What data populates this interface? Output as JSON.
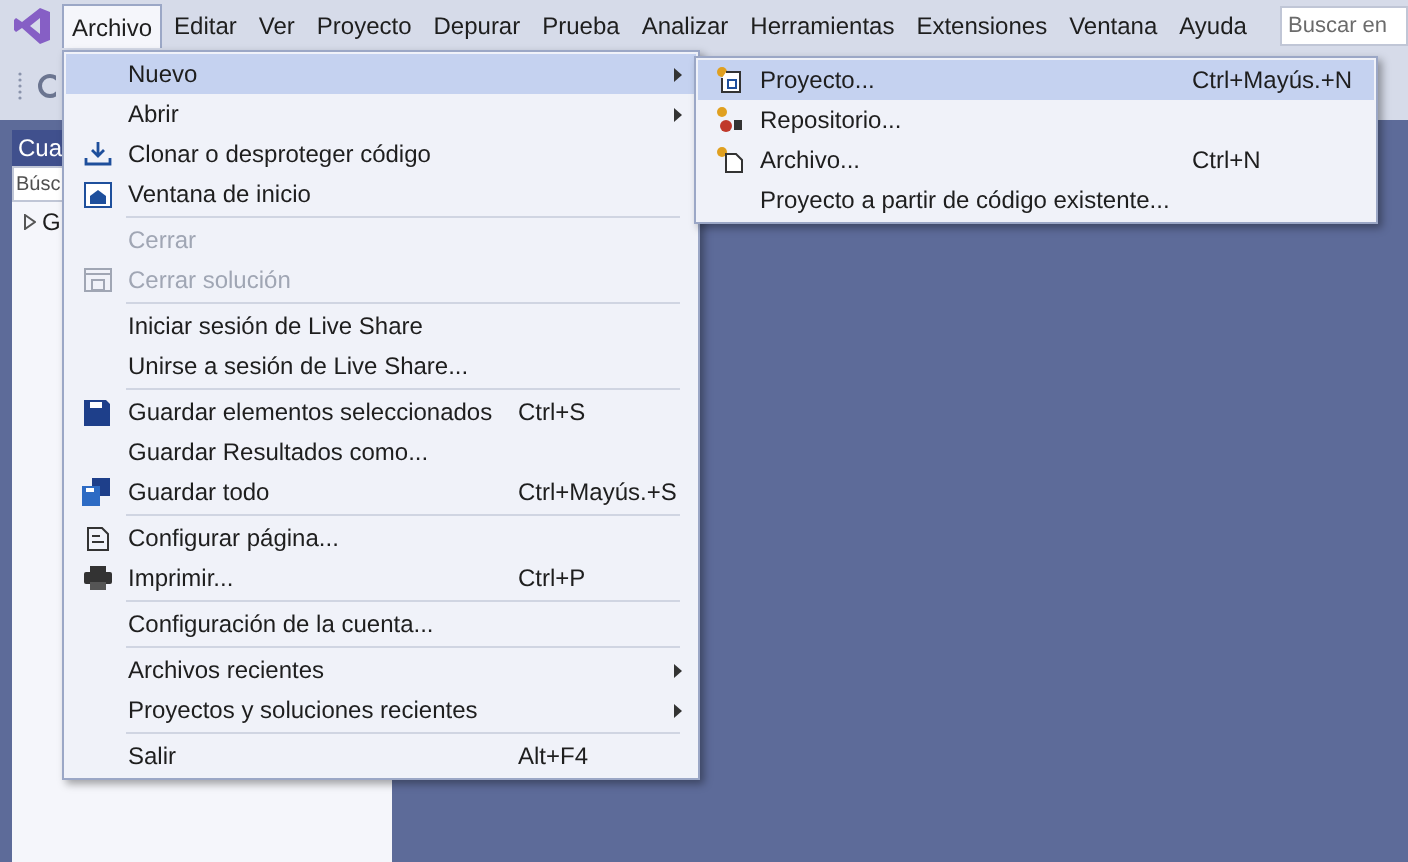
{
  "menubar": {
    "items": [
      {
        "label": "Archivo",
        "selected": true
      },
      {
        "label": "Editar",
        "selected": false
      },
      {
        "label": "Ver",
        "selected": false
      },
      {
        "label": "Proyecto",
        "selected": false
      },
      {
        "label": "Depurar",
        "selected": false
      },
      {
        "label": "Prueba",
        "selected": false
      },
      {
        "label": "Analizar",
        "selected": false
      },
      {
        "label": "Herramientas",
        "selected": false
      },
      {
        "label": "Extensiones",
        "selected": false
      },
      {
        "label": "Ventana",
        "selected": false
      },
      {
        "label": "Ayuda",
        "selected": false
      }
    ],
    "search": {
      "placeholder": "Buscar en"
    }
  },
  "side_panel": {
    "title": "Cua",
    "search": {
      "placeholder": "Búsc"
    },
    "tree": [
      {
        "label": "G",
        "expanded": false
      }
    ]
  },
  "file_menu": {
    "items": [
      {
        "kind": "item",
        "label": "Nuevo",
        "has_submenu": true,
        "selected": true,
        "disabled": false
      },
      {
        "kind": "item",
        "label": "Abrir",
        "has_submenu": true,
        "selected": false,
        "disabled": false
      },
      {
        "kind": "item",
        "label": "Clonar o desproteger código",
        "has_submenu": false,
        "selected": false,
        "disabled": false
      },
      {
        "kind": "item",
        "label": "Ventana de inicio",
        "has_submenu": false,
        "selected": false,
        "disabled": false
      },
      {
        "kind": "separator"
      },
      {
        "kind": "item",
        "label": "Cerrar",
        "has_submenu": false,
        "selected": false,
        "disabled": true
      },
      {
        "kind": "item",
        "label": "Cerrar solución",
        "has_submenu": false,
        "selected": false,
        "disabled": true
      },
      {
        "kind": "separator"
      },
      {
        "kind": "item",
        "label": "Iniciar sesión de Live Share",
        "has_submenu": false,
        "selected": false,
        "disabled": false
      },
      {
        "kind": "item",
        "label": "Unirse a sesión de Live Share...",
        "has_submenu": false,
        "selected": false,
        "disabled": false
      },
      {
        "kind": "separator"
      },
      {
        "kind": "item",
        "label": "Guardar elementos seleccionados",
        "shortcut": "Ctrl+S",
        "has_submenu": false,
        "selected": false,
        "disabled": false
      },
      {
        "kind": "item",
        "label": "Guardar Resultados como...",
        "has_submenu": false,
        "selected": false,
        "disabled": false
      },
      {
        "kind": "item",
        "label": "Guardar todo",
        "shortcut": "Ctrl+Mayús.+S",
        "has_submenu": false,
        "selected": false,
        "disabled": false
      },
      {
        "kind": "separator"
      },
      {
        "kind": "item",
        "label": "Configurar página...",
        "has_submenu": false,
        "selected": false,
        "disabled": false
      },
      {
        "kind": "item",
        "label": "Imprimir...",
        "shortcut": "Ctrl+P",
        "has_submenu": false,
        "selected": false,
        "disabled": false
      },
      {
        "kind": "separator"
      },
      {
        "kind": "item",
        "label": "Configuración de la cuenta...",
        "has_submenu": false,
        "selected": false,
        "disabled": false
      },
      {
        "kind": "separator"
      },
      {
        "kind": "item",
        "label": "Archivos recientes",
        "has_submenu": true,
        "selected": false,
        "disabled": false
      },
      {
        "kind": "item",
        "label": "Proyectos y soluciones recientes",
        "has_submenu": true,
        "selected": false,
        "disabled": false
      },
      {
        "kind": "separator"
      },
      {
        "kind": "item",
        "label": "Salir",
        "shortcut": "Alt+F4",
        "has_submenu": false,
        "selected": false,
        "disabled": false
      }
    ]
  },
  "new_submenu": {
    "items": [
      {
        "label": "Proyecto...",
        "shortcut": "Ctrl+Mayús.+N",
        "selected": true
      },
      {
        "label": "Repositorio...",
        "selected": false
      },
      {
        "label": "Archivo...",
        "shortcut": "Ctrl+N",
        "selected": false
      },
      {
        "label": "Proyecto a partir de código existente...",
        "selected": false
      }
    ]
  }
}
